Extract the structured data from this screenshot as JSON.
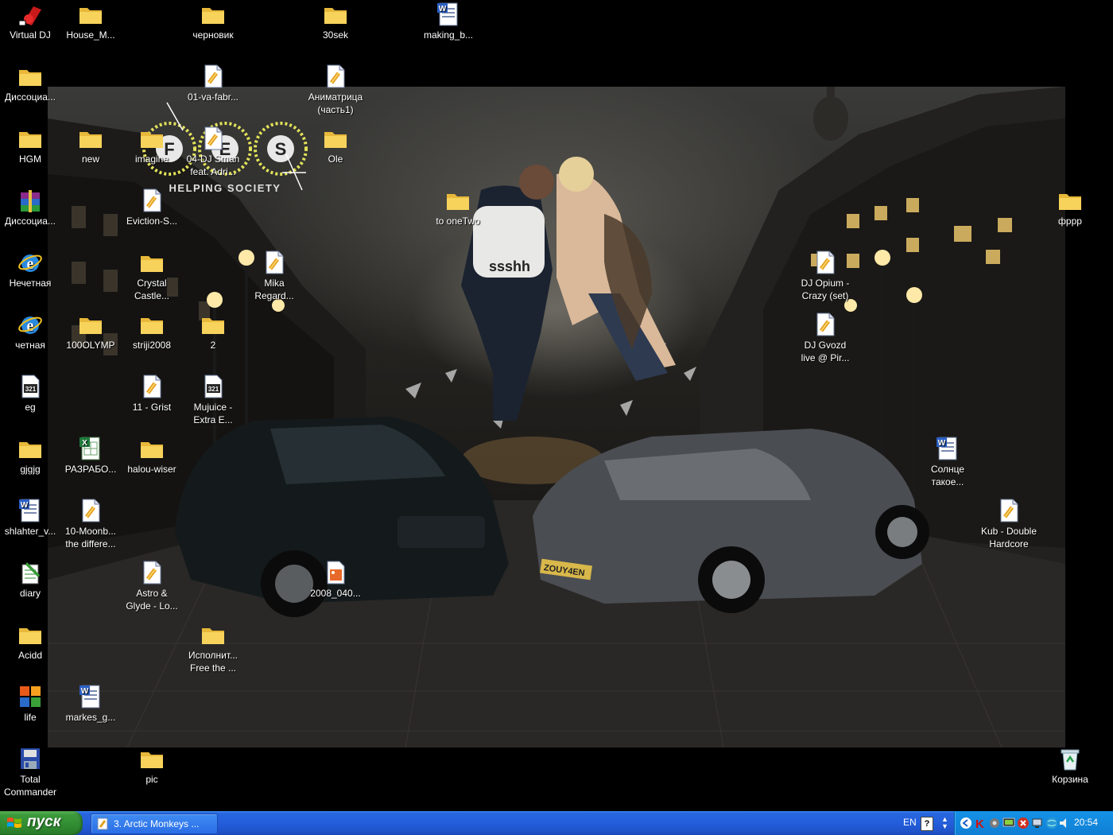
{
  "desktop": {
    "icons": [
      {
        "label": "Virtual DJ",
        "icon": "virtual-dj-icon"
      },
      {
        "label": "House_M...",
        "icon": "folder-icon"
      },
      {
        "label": "черновик",
        "icon": "folder-icon"
      },
      {
        "label": "30sek",
        "icon": "folder-icon"
      },
      {
        "label": "making_b...",
        "icon": "word-document-icon"
      },
      {
        "label": "Диссоциа...",
        "icon": "folder-icon"
      },
      {
        "label": "01-va-fabr...",
        "icon": "audio-file-icon"
      },
      {
        "label": "Аниматрица\n(часть1)",
        "icon": "audio-file-icon"
      },
      {
        "label": "HGM",
        "icon": "folder-icon"
      },
      {
        "label": "new",
        "icon": "folder-icon"
      },
      {
        "label": "imagine",
        "icon": "folder-icon"
      },
      {
        "label": "04-DJ Smah\nfeat. Adri...",
        "icon": "audio-file-icon"
      },
      {
        "label": "Ole",
        "icon": "folder-icon"
      },
      {
        "label": "Диссоциа...",
        "icon": "winrar-archive-icon"
      },
      {
        "label": "Eviction-S...",
        "icon": "audio-file-icon"
      },
      {
        "label": "to oneTwo",
        "icon": "folder-icon"
      },
      {
        "label": "фррр",
        "icon": "folder-icon"
      },
      {
        "label": "Нечетная",
        "icon": "internet-explorer-icon"
      },
      {
        "label": "Crystal\nCastle...",
        "icon": "folder-icon"
      },
      {
        "label": "Mika\nRegard...",
        "icon": "audio-file-icon"
      },
      {
        "label": "DJ Opium -\nCrazy (set)",
        "icon": "audio-file-icon"
      },
      {
        "label": "четная",
        "icon": "internet-explorer-icon"
      },
      {
        "label": "100OLYMP",
        "icon": "folder-icon"
      },
      {
        "label": "striji2008",
        "icon": "folder-icon"
      },
      {
        "label": "2",
        "icon": "folder-icon"
      },
      {
        "label": "DJ Gvozd\nlive @ Pir...",
        "icon": "audio-file-icon"
      },
      {
        "label": "eg",
        "icon": "media-file-icon"
      },
      {
        "label": "11 - Grist",
        "icon": "audio-file-icon"
      },
      {
        "label": "Mujuice -\nExtra E...",
        "icon": "media-file-icon"
      },
      {
        "label": "gjgjg",
        "icon": "folder-icon"
      },
      {
        "label": "РАЗРАБО...",
        "icon": "excel-document-icon"
      },
      {
        "label": "halou-wiser",
        "icon": "folder-icon"
      },
      {
        "label": "Солнце\nтакое...",
        "icon": "word-document-icon"
      },
      {
        "label": "shlahter_v...",
        "icon": "word-document-icon"
      },
      {
        "label": "10-Moonb...\nthe differe...",
        "icon": "audio-file-icon"
      },
      {
        "label": "Kub - Double\nHardcore",
        "icon": "audio-file-icon"
      },
      {
        "label": "diary",
        "icon": "notepad-icon"
      },
      {
        "label": "Astro &\nGlyde - Lo...",
        "icon": "audio-file-icon"
      },
      {
        "label": "2008_040...",
        "icon": "image-file-icon"
      },
      {
        "label": "Acidd",
        "icon": "folder-icon"
      },
      {
        "label": "Исполнит...\nFree the ...",
        "icon": "folder-icon"
      },
      {
        "label": "life",
        "icon": "office-shortcut-icon"
      },
      {
        "label": "markes_g...",
        "icon": "word-document-icon"
      },
      {
        "label": "Total\nCommander",
        "icon": "total-commander-icon"
      },
      {
        "label": "pic",
        "icon": "folder-icon"
      },
      {
        "label": "Корзина",
        "icon": "recycle-bin-icon"
      }
    ],
    "wallpaper": {
      "logo_letters": [
        "F",
        "E",
        "S"
      ],
      "logo_caption": "HELPING SOCIETY",
      "shirt_text": "ssshh",
      "plate_text": "ZOUY4EN"
    }
  },
  "taskbar": {
    "start_label": "пуск",
    "task_label": "3. Arctic Monkeys ...",
    "language": "EN",
    "help_glyph": "?",
    "clock": "20:54"
  }
}
